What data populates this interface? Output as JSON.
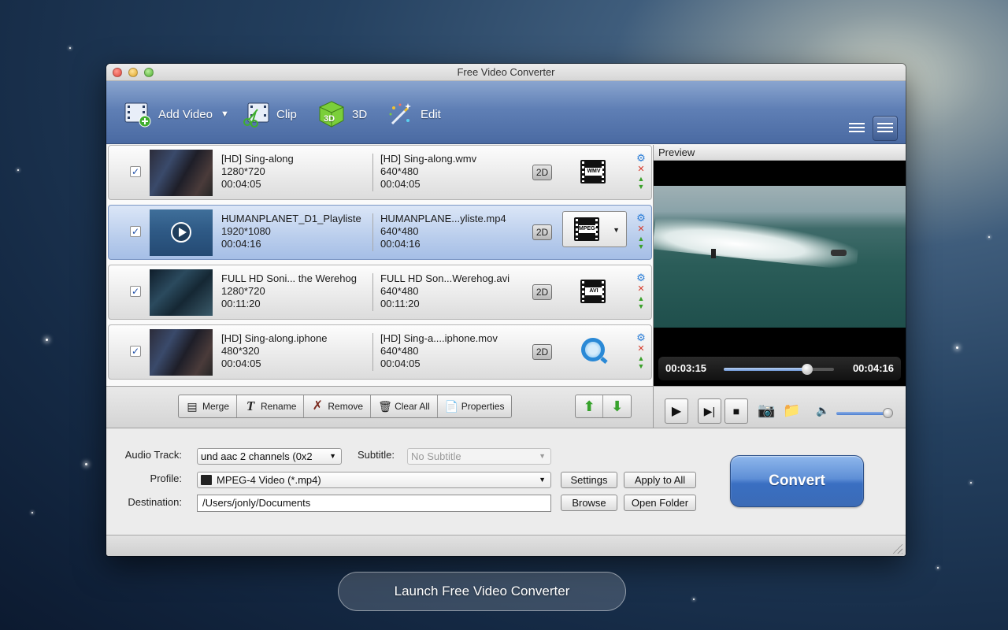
{
  "window": {
    "title": "Free Video Converter"
  },
  "toolbar": {
    "add_video": "Add Video",
    "clip": "Clip",
    "three_d": "3D",
    "edit": "Edit",
    "three_d_badge": "3D"
  },
  "files": [
    {
      "src_name": "[HD] Sing-along",
      "src_res": "1280*720",
      "src_dur": "00:04:05",
      "dst_name": "[HD] Sing-along.wmv",
      "dst_res": "640*480",
      "dst_dur": "00:04:05",
      "mode": "2D",
      "format_label": "WMV"
    },
    {
      "src_name": "HUMANPLANET_D1_Playliste",
      "src_res": "1920*1080",
      "src_dur": "00:04:16",
      "dst_name": "HUMANPLANE...yliste.mp4",
      "dst_res": "640*480",
      "dst_dur": "00:04:16",
      "mode": "2D",
      "format_label": "MPEG4"
    },
    {
      "src_name": "FULL HD Soni... the Werehog",
      "src_res": "1280*720",
      "src_dur": "00:11:20",
      "dst_name": "FULL HD Son...Werehog.avi",
      "dst_res": "640*480",
      "dst_dur": "00:11:20",
      "mode": "2D",
      "format_label": "AVI"
    },
    {
      "src_name": "[HD] Sing-along.iphone",
      "src_res": "480*320",
      "src_dur": "00:04:05",
      "dst_name": "[HD] Sing-a....iphone.mov",
      "dst_res": "640*480",
      "dst_dur": "00:04:05",
      "mode": "2D",
      "format_label": ""
    }
  ],
  "preview": {
    "title": "Preview",
    "current_time": "00:03:15",
    "total_time": "00:04:16",
    "progress": 0.76,
    "volume": 1.0
  },
  "actions": {
    "merge": "Merge",
    "rename": "Rename",
    "remove": "Remove",
    "clear_all": "Clear All",
    "properties": "Properties"
  },
  "options": {
    "audio_track_label": "Audio Track:",
    "audio_track_value": "und aac 2 channels (0x2",
    "subtitle_label": "Subtitle:",
    "subtitle_value": "No Subtitle",
    "profile_label": "Profile:",
    "profile_value": "MPEG-4 Video (*.mp4)",
    "destination_label": "Destination:",
    "destination_value": "/Users/jonly/Documents",
    "settings": "Settings",
    "apply_to_all": "Apply to All",
    "browse": "Browse",
    "open_folder": "Open Folder",
    "convert": "Convert"
  },
  "launch_button": "Launch Free Video Converter"
}
